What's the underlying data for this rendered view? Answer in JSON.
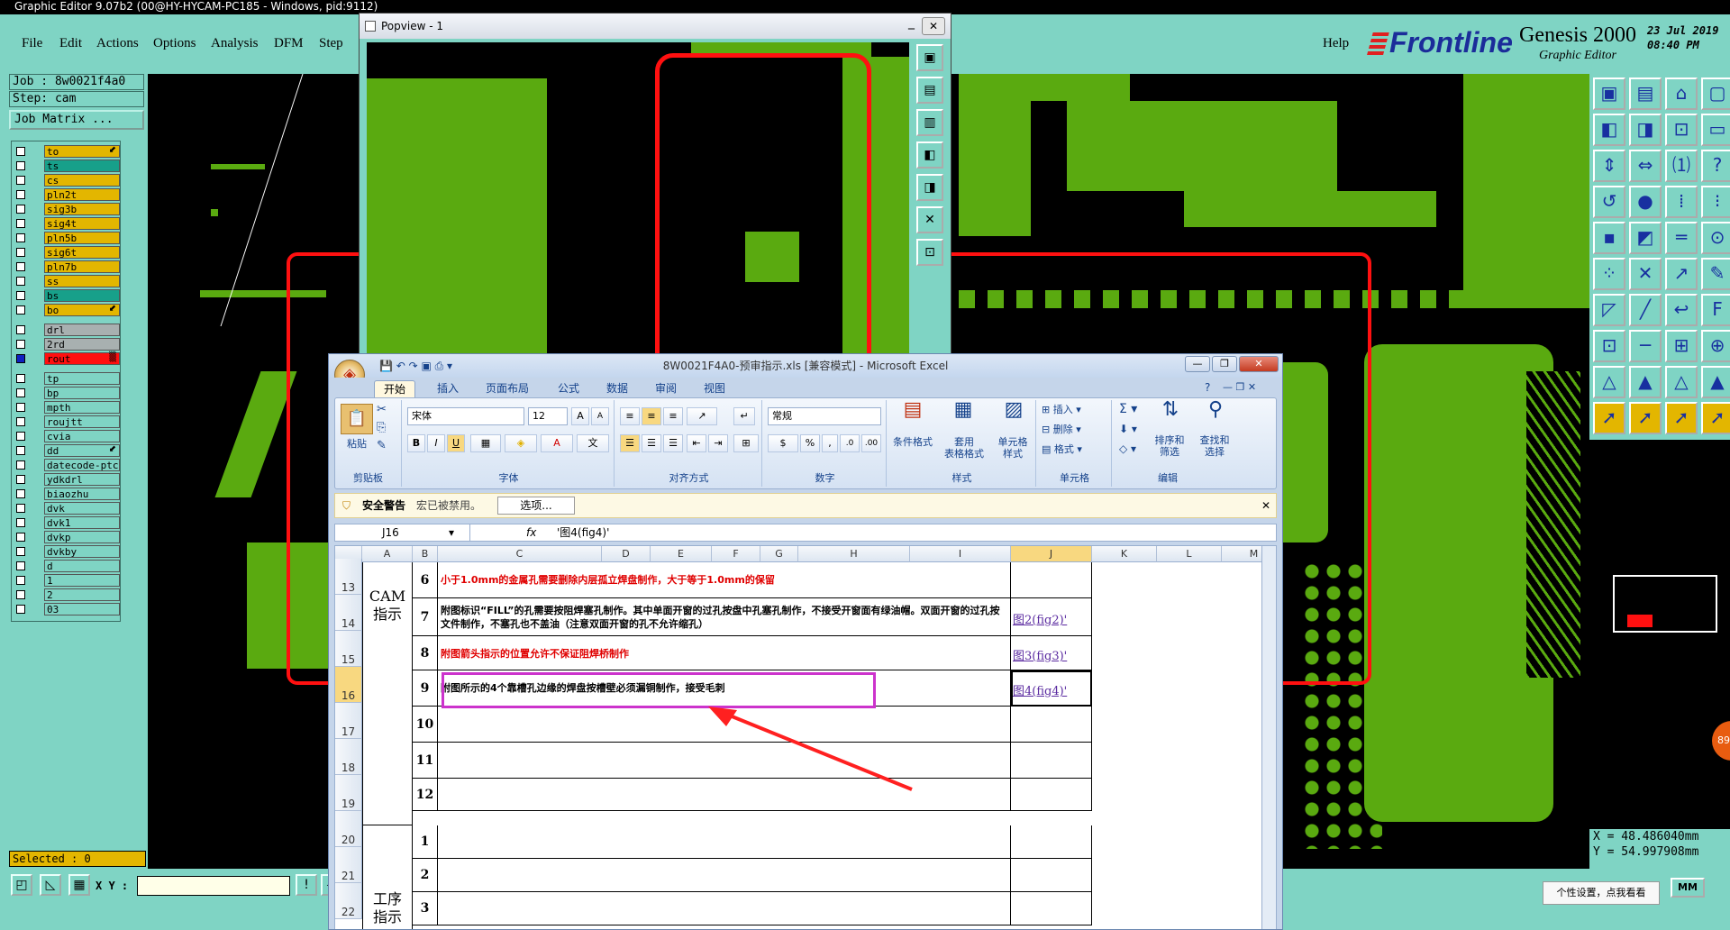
{
  "app": {
    "title": "Graphic Editor 9.07b2 (00@HY-HYCAM-PC185 - Windows, pid:9112)"
  },
  "menu": [
    "File",
    "Edit",
    "Actions",
    "Options",
    "Analysis",
    "DFM",
    "Step"
  ],
  "help": "Help",
  "brand": {
    "logo": "Frontline",
    "product": "Genesis 2000",
    "sub": "Graphic Editor",
    "date": "23 Jul 2019\n08:40 PM"
  },
  "job": {
    "job": "Job : 8w0021f4a0",
    "step": "Step: cam",
    "matrix": "Job Matrix ..."
  },
  "layers": [
    {
      "name": "to",
      "color": "#e3b600",
      "arrow": "⬋"
    },
    {
      "name": "ts",
      "color": "#17a08a",
      "arrow": ""
    },
    {
      "name": "cs",
      "color": "#e3b600",
      "arrow": ""
    },
    {
      "name": "pln2t",
      "color": "#e3b600",
      "arrow": ""
    },
    {
      "name": "sig3b",
      "color": "#e3b600",
      "arrow": ""
    },
    {
      "name": "sig4t",
      "color": "#e3b600",
      "arrow": ""
    },
    {
      "name": "pln5b",
      "color": "#e3b600",
      "arrow": ""
    },
    {
      "name": "sig6t",
      "color": "#e3b600",
      "arrow": ""
    },
    {
      "name": "pln7b",
      "color": "#e3b600",
      "arrow": ""
    },
    {
      "name": "ss",
      "color": "#e3b600",
      "arrow": ""
    },
    {
      "name": "bs",
      "color": "#17a08a",
      "arrow": ""
    },
    {
      "name": "bo",
      "color": "#e3b600",
      "arrow": "⬋"
    },
    {
      "name": "drl",
      "color": "#a8b0b0",
      "arrow": ""
    },
    {
      "name": "2rd",
      "color": "#a8b0b0",
      "arrow": ""
    },
    {
      "name": "rout",
      "color": "#ff1010",
      "arrow": "▒"
    },
    {
      "name": "tp",
      "color": "#7fd4c4",
      "arrow": ""
    },
    {
      "name": "bp",
      "color": "#7fd4c4",
      "arrow": ""
    },
    {
      "name": "mpth",
      "color": "#7fd4c4",
      "arrow": ""
    },
    {
      "name": "roujtt",
      "color": "#7fd4c4",
      "arrow": ""
    },
    {
      "name": "cvia",
      "color": "#7fd4c4",
      "arrow": ""
    },
    {
      "name": "dd",
      "color": "#7fd4c4",
      "arrow": "⬋"
    },
    {
      "name": "datecode-ptc",
      "color": "#7fd4c4",
      "arrow": ""
    },
    {
      "name": "ydkdrl",
      "color": "#7fd4c4",
      "arrow": ""
    },
    {
      "name": "biaozhu",
      "color": "#7fd4c4",
      "arrow": ""
    },
    {
      "name": "dvk",
      "color": "#7fd4c4",
      "arrow": ""
    },
    {
      "name": "dvk1",
      "color": "#7fd4c4",
      "arrow": ""
    },
    {
      "name": "dvkp",
      "color": "#7fd4c4",
      "arrow": ""
    },
    {
      "name": "dvkby",
      "color": "#7fd4c4",
      "arrow": ""
    },
    {
      "name": "d",
      "color": "#7fd4c4",
      "arrow": ""
    },
    {
      "name": "1",
      "color": "#7fd4c4",
      "arrow": ""
    },
    {
      "name": "2",
      "color": "#7fd4c4",
      "arrow": ""
    },
    {
      "name": "03",
      "color": "#7fd4c4",
      "arrow": ""
    }
  ],
  "selected": "Selected : 0",
  "xy": {
    "label": "X Y :",
    "mm": "MM"
  },
  "coords": "X = 48.486040mm\nY = 54.997908mm",
  "popview": {
    "title": "Popview - 1"
  },
  "excel": {
    "title": "8W0021F4A0-预审指示.xls [兼容模式] - Microsoft Excel",
    "tabs": [
      "开始",
      "插入",
      "页面布局",
      "公式",
      "数据",
      "审阅",
      "视图"
    ],
    "groups": {
      "clipboard": "剪贴板",
      "font": "字体",
      "align": "对齐方式",
      "number": "数字",
      "styles": "样式",
      "cells": "单元格",
      "edit": "编辑"
    },
    "paste": "粘贴",
    "font_name": "宋体",
    "font_size": "12",
    "number_format": "常规",
    "cond_format": "条件格式",
    "table_format": "套用\n表格格式",
    "cell_style": "单元格\n样式",
    "insert": "插入",
    "delete": "删除",
    "format": "格式",
    "sort": "排序和\n筛选",
    "find": "查找和\n选择",
    "security": {
      "label": "安全警告",
      "msg": "宏已被禁用。",
      "btn": "选项..."
    },
    "namebox": "J16",
    "formula": "'图4(fig4)'",
    "cols": [
      "A",
      "B",
      "C",
      "D",
      "E",
      "F",
      "G",
      "H",
      "I",
      "J",
      "K",
      "L",
      "M"
    ],
    "rows": [
      "13",
      "14",
      "15",
      "16",
      "17",
      "18",
      "19",
      "20",
      "21",
      "22"
    ],
    "cam": "CAM\n指示",
    "proc": "工序\n指示",
    "items": [
      {
        "n": "6",
        "text": "小于1.0mm的金属孔需要删除内层孤立焊盘制作，大于等于1.0mm的保留",
        "red": true,
        "link": ""
      },
      {
        "n": "7",
        "text": "附图标识“FILL”的孔需要按阻焊塞孔制作。其中单面开窗的过孔按盘中孔塞孔制作，不接受开窗面有绿油帽。双面开窗的过孔按文件制作，不塞孔也不盖油（注意双面开窗的孔不允许缩孔）",
        "red": false,
        "link": "图2(fig2)'"
      },
      {
        "n": "8",
        "text": "附图箭头指示的位置允许不保证阻焊桥制作",
        "red": true,
        "link": "图3(fig3)'"
      },
      {
        "n": "9",
        "text": "附图所示的4个靠槽孔边缘的焊盘按槽壁必须漏铜制作，接受毛刺",
        "red": false,
        "link": "图4(fig4)'"
      },
      {
        "n": "10",
        "text": "",
        "red": false,
        "link": ""
      },
      {
        "n": "11",
        "text": "",
        "red": false,
        "link": ""
      },
      {
        "n": "12",
        "text": "",
        "red": false,
        "link": ""
      }
    ],
    "proc_items": [
      "1",
      "2",
      "3"
    ]
  },
  "tooltip": "个性设置，点我看看",
  "badge": "89"
}
